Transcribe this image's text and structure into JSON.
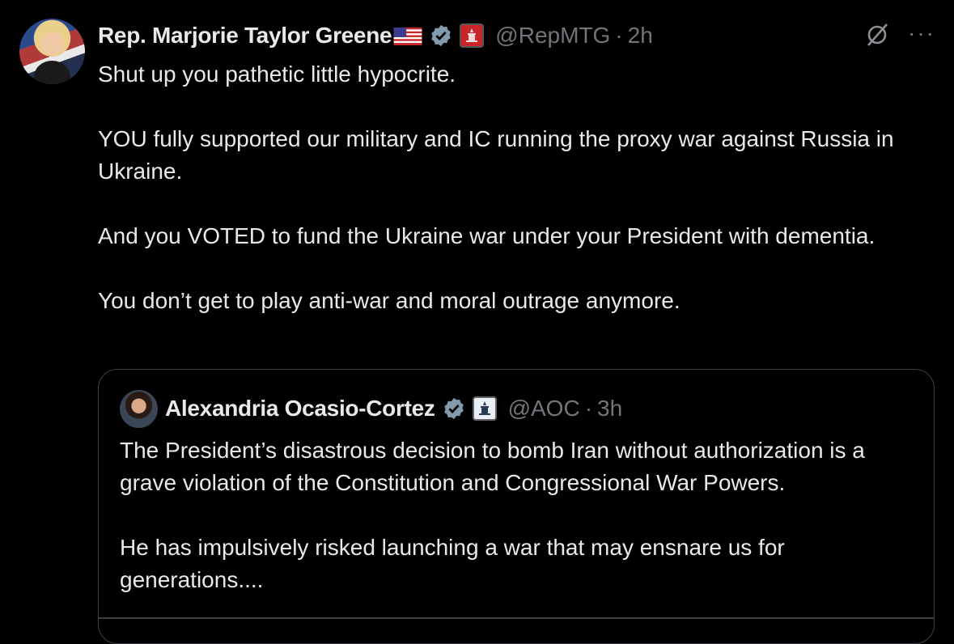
{
  "tweet": {
    "author": {
      "name": "Rep. Marjorie Taylor Greene",
      "handle": "@RepMTG",
      "time": "2h"
    },
    "separator": "·",
    "more": "···",
    "paragraphs": [
      "Shut up you pathetic little hypocrite.",
      "YOU fully supported our military and IC running the proxy war against Russia in Ukraine.",
      "And you VOTED to fund the Ukraine war under your President with dementia.",
      "You don’t get to play anti-war and moral outrage anymore."
    ]
  },
  "quote": {
    "author": {
      "name": "Alexandria Ocasio-Cortez",
      "handle": "@AOC",
      "time": "3h"
    },
    "separator": "·",
    "paragraphs": [
      "The President’s disastrous decision to bomb Iran without authorization is a grave violation of the Constitution and Congressional War Powers.",
      "He has impulsively risked launching a war that may ensnare us for generations...."
    ]
  },
  "colors": {
    "background": "#000000",
    "text": "#e7e9ea",
    "muted": "#71767b",
    "verified": "#829aab",
    "border": "#3b3f44"
  },
  "icons": [
    "us-flag-icon",
    "verified-badge-icon",
    "government-affiliation-icon",
    "grok-icon",
    "more-icon"
  ]
}
